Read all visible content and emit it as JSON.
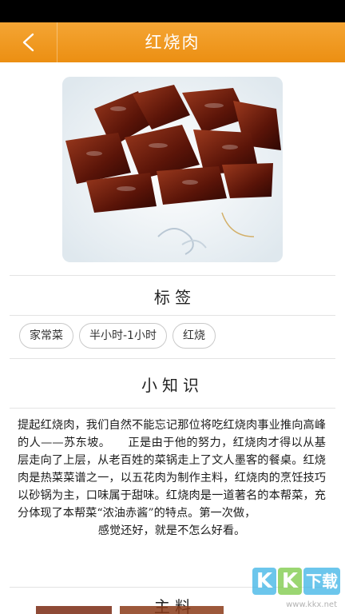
{
  "header": {
    "title": "红烧肉",
    "back_icon": "chevron-left-icon",
    "accent_color": "#f09a22"
  },
  "dish_photo": {
    "subject": "red-braised pork on a white plate"
  },
  "tags_section": {
    "title": "标 签",
    "tags": [
      "家常菜",
      "半小时-1小时",
      "红烧"
    ]
  },
  "knowledge_section": {
    "title": "小知识",
    "body": "提起红烧肉，我们自然不能忘记那位将吃红烧肉事业推向高峰的人——苏东坡。　　正是由于他的努力，红烧肉才得以从基层走向了上层，从老百姓的菜锅走上了文人墨客的餐桌。红烧肉是热菜菜谱之一，以五花肉为制作主料，红烧肉的烹饪技巧以砂锅为主，口味属于甜味。红烧肉是一道著名的本帮菜，充分体现了本帮菜“浓油赤酱”的特点。第一次做，",
    "last_line": "感觉还好，就是不怎么好看。"
  },
  "ingredients_section": {
    "title": "主 料"
  },
  "watermark": {
    "k1": "K",
    "k2": "K",
    "k3": "下载",
    "url": "www.kkx.net"
  }
}
